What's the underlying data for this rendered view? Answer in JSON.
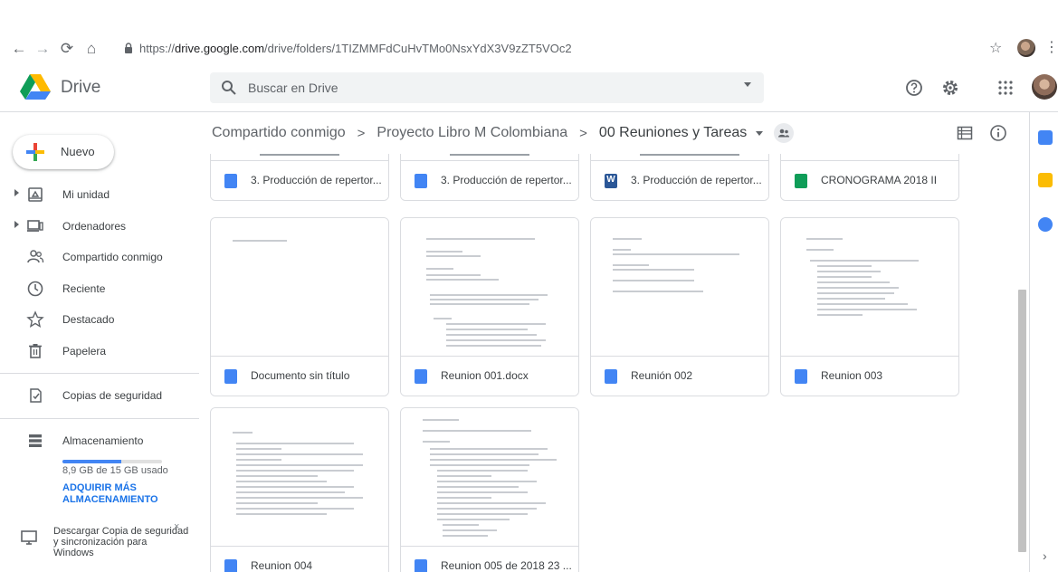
{
  "browser": {
    "url_scheme": "https://",
    "url_host": "drive.google.com",
    "url_path": "/drive/folders/1TIZMMFdCuHvTMo0NsxYdX3V9zZT5VOc2"
  },
  "header": {
    "product": "Drive",
    "search_placeholder": "Buscar en Drive"
  },
  "sidebar": {
    "new_label": "Nuevo",
    "items": [
      {
        "label": "Mi unidad"
      },
      {
        "label": "Ordenadores"
      },
      {
        "label": "Compartido conmigo"
      },
      {
        "label": "Reciente"
      },
      {
        "label": "Destacado"
      },
      {
        "label": "Papelera"
      },
      {
        "label": "Copias de seguridad"
      },
      {
        "label": "Almacenamiento"
      }
    ],
    "storage_text": "8,9 GB de 15 GB usado",
    "storage_fraction": 0.593,
    "upgrade_label": "ADQUIRIR MÁS ALMACENAMIENTO",
    "promo_text": "Descargar Copia de seguridad y sincronización para Windows",
    "promo_close": "×"
  },
  "breadcrumb": {
    "items": [
      "Compartido conmigo",
      "Proyecto Libro M Colombiana",
      "00 Reuniones y Tareas"
    ],
    "separator": ">"
  },
  "files": [
    {
      "name": "3. Producción de repertor...",
      "type": "doc"
    },
    {
      "name": "3. Producción de repertor...",
      "type": "doc"
    },
    {
      "name": "3. Producción de repertor...",
      "type": "word",
      "type_letter": "W"
    },
    {
      "name": "CRONOGRAMA 2018 II",
      "type": "sheet"
    },
    {
      "name": "Documento sin título",
      "type": "doc"
    },
    {
      "name": "Reunion 001.docx",
      "type": "doc"
    },
    {
      "name": "Reunión 002",
      "type": "doc"
    },
    {
      "name": "Reunion 003",
      "type": "doc"
    },
    {
      "name": "Reunion 004",
      "type": "doc"
    },
    {
      "name": "Reunion 005 de 2018 23 ...",
      "type": "doc"
    }
  ],
  "colors": {
    "accent": "#1a73e8",
    "doc": "#4285f4",
    "sheet": "#0f9d58",
    "word": "#2b5797"
  }
}
